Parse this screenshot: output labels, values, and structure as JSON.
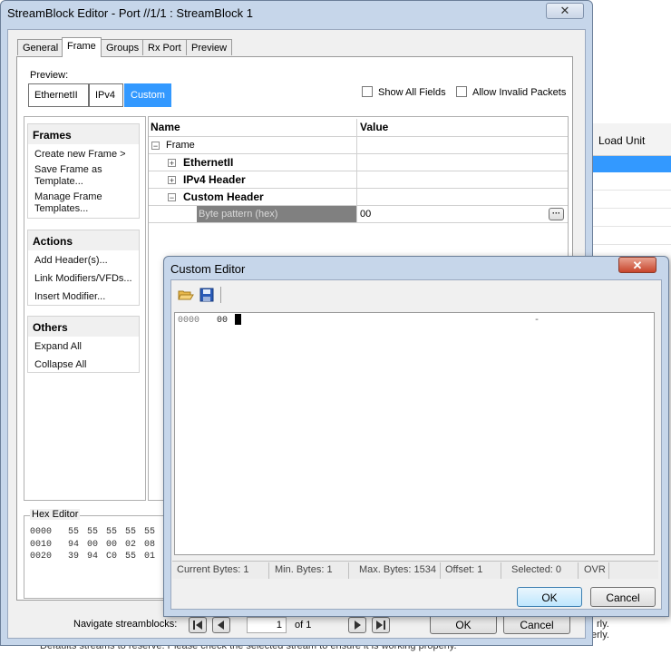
{
  "background_app": {
    "column_header": "Load Unit",
    "footer_lines": [
      "rly.",
      "erly."
    ],
    "status_text": "Defaults streams to reserve. Please check the selected stream to ensure it is working properly."
  },
  "main_window": {
    "title": "StreamBlock Editor - Port //1/1 : StreamBlock 1",
    "close_glyph": "✕",
    "tabs": [
      "General",
      "Frame",
      "Groups",
      "Rx Port",
      "Preview"
    ],
    "active_tab": "Frame",
    "preview_label": "Preview:",
    "preview_buttons": [
      "EthernetII",
      "IPv4",
      "Custom"
    ],
    "selected_preview": "Custom",
    "show_all_fields": "Show All Fields",
    "allow_invalid_packets": "Allow Invalid Packets",
    "sidebar": {
      "frames": {
        "title": "Frames",
        "items": [
          "Create new Frame >",
          "Save Frame as Template...",
          "Manage Frame Templates..."
        ]
      },
      "actions": {
        "title": "Actions",
        "items": [
          "Add Header(s)...",
          "Link Modifiers/VFDs...",
          "Insert Modifier..."
        ]
      },
      "others": {
        "title": "Others",
        "items": [
          "Expand All",
          "Collapse All"
        ]
      }
    },
    "grid": {
      "col_name": "Name",
      "col_value": "Value",
      "root": "Frame",
      "nodes": [
        "EthernetII",
        "IPv4 Header",
        "Custom Header"
      ],
      "field_name": "Byte pattern (hex)",
      "field_value": "00",
      "ellipsis": "···"
    },
    "hex_editor": {
      "title": "Hex Editor",
      "rows": [
        {
          "offset": "0000",
          "bytes": "55 55 55 55 55"
        },
        {
          "offset": "0010",
          "bytes": "94 00 00 02 08"
        },
        {
          "offset": "0020",
          "bytes": "39 94 C0 55 01"
        }
      ]
    },
    "navigate_label": "Navigate streamblocks:",
    "page_value": "1",
    "page_of": "of 1",
    "ok": "OK",
    "cancel": "Cancel"
  },
  "custom_editor": {
    "title": "Custom Editor",
    "close_glyph": "✕",
    "offset": "0000",
    "bytes": "00",
    "marker": "-",
    "status": {
      "current_bytes": "Current Bytes:  1",
      "min_bytes": "Min. Bytes:  1",
      "max_bytes": "Max. Bytes:  1534",
      "offset": "Offset:  1",
      "selected": "Selected:  0",
      "mode": "OVR"
    },
    "ok": "OK",
    "cancel": "Cancel"
  },
  "colors": {
    "title_bar": "#c6d6ea",
    "selection": "#3399ff",
    "close_red": "#c8452c"
  }
}
